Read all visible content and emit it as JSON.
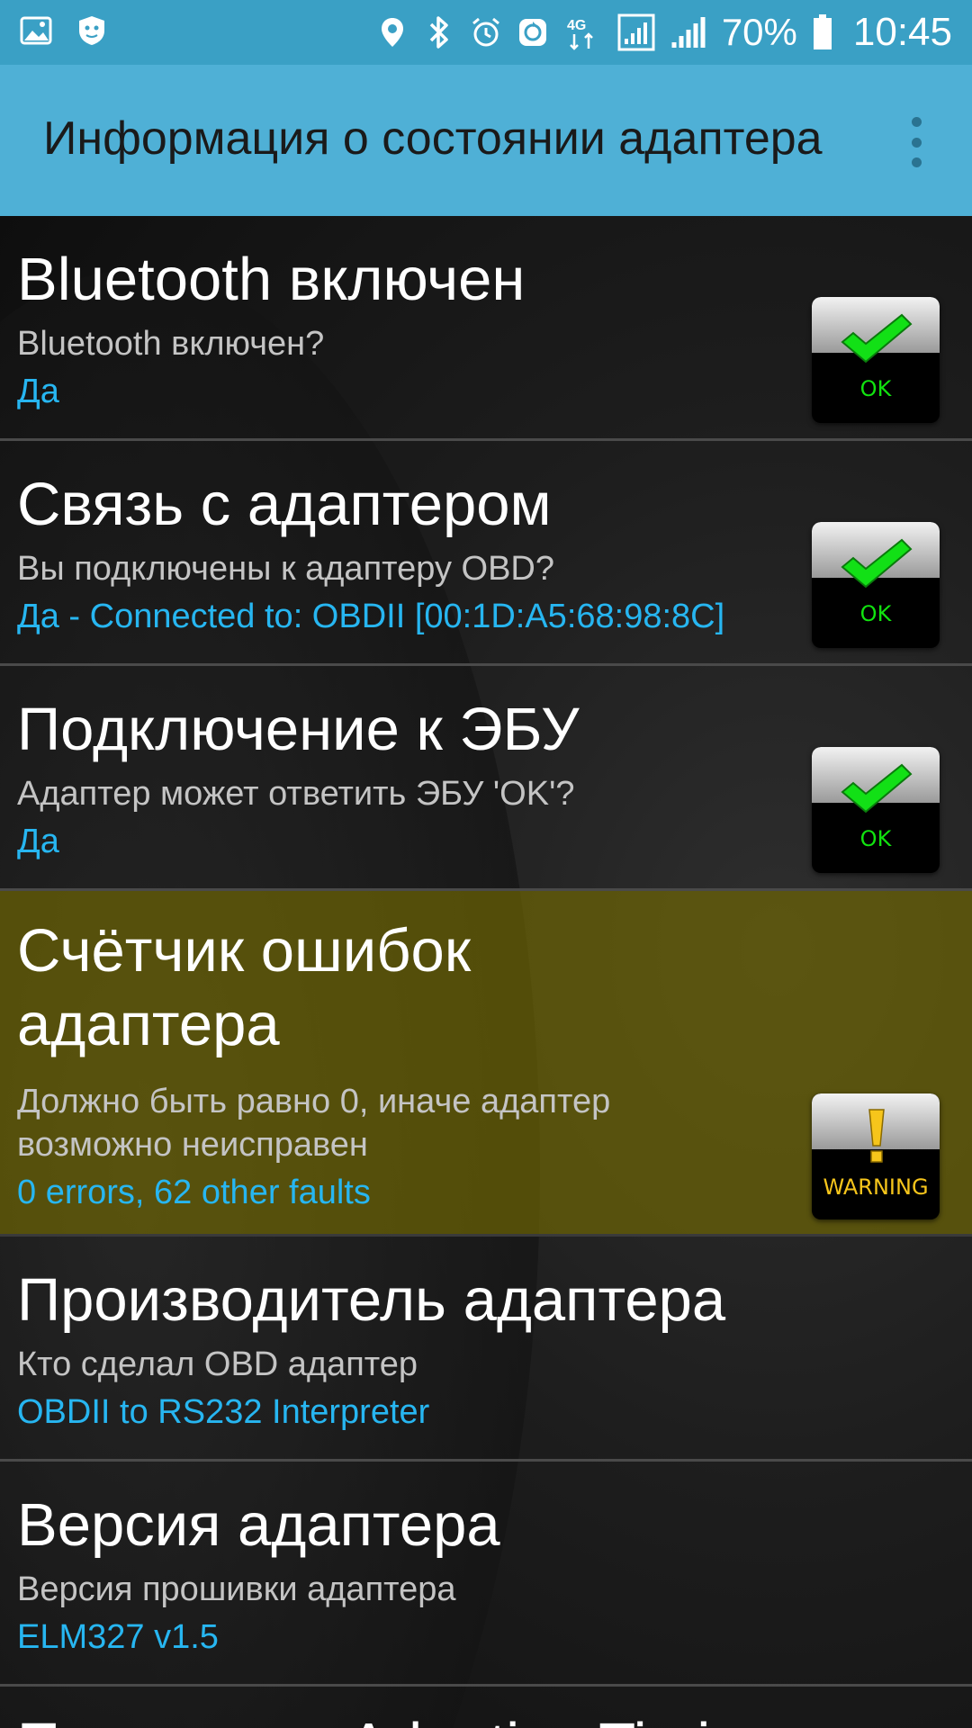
{
  "status_bar": {
    "icons_left": [
      "image-icon",
      "shield-cat-icon"
    ],
    "icons_right": [
      "location-icon",
      "bluetooth-icon",
      "alarm-icon",
      "sync-icon",
      "network-4g-icon",
      "signal-icon",
      "signal-icon-2",
      "battery-icon"
    ],
    "network_type": "4G",
    "battery": "70%",
    "time": "10:45"
  },
  "app_bar": {
    "title": "Информация о состоянии адаптера",
    "menu_icon": "overflow-menu-icon"
  },
  "items": [
    {
      "title": "Bluetooth включен",
      "subtitle": "Bluetooth включен?",
      "value": "Да",
      "status": "OK"
    },
    {
      "title": "Связь с адаптером",
      "subtitle": "Вы подключены к адаптеру OBD?",
      "value": "Да - Connected to: OBDII [00:1D:A5:68:98:8C]",
      "status": "OK"
    },
    {
      "title": "Подключение к ЭБУ",
      "subtitle": "Адаптер может ответить ЭБУ 'OK'?",
      "value": "Да",
      "status": "OK"
    },
    {
      "title": "Счётчик ошибок адаптера",
      "subtitle": "Должно быть равно 0, иначе адаптер возможно неисправен",
      "value": "0 errors, 62 other faults",
      "status": "WARNING"
    },
    {
      "title": "Производитель адаптера",
      "subtitle": "Кто сделал OBD адаптер",
      "value": "OBDII to RS232 Interpreter"
    },
    {
      "title": "Версия адаптера",
      "subtitle": "Версия прошивки адаптера",
      "value": "ELM327 v1.5"
    },
    {
      "title": "Поддержка Adaptive Timing"
    }
  ],
  "colors": {
    "app_bar": "#4fb0d6",
    "status_bar": "#3aa0c5",
    "value_text": "#27b6f1",
    "ok_green": "#11e20f",
    "warning_yellow": "#f6c51b",
    "warning_row": "#786e00"
  }
}
